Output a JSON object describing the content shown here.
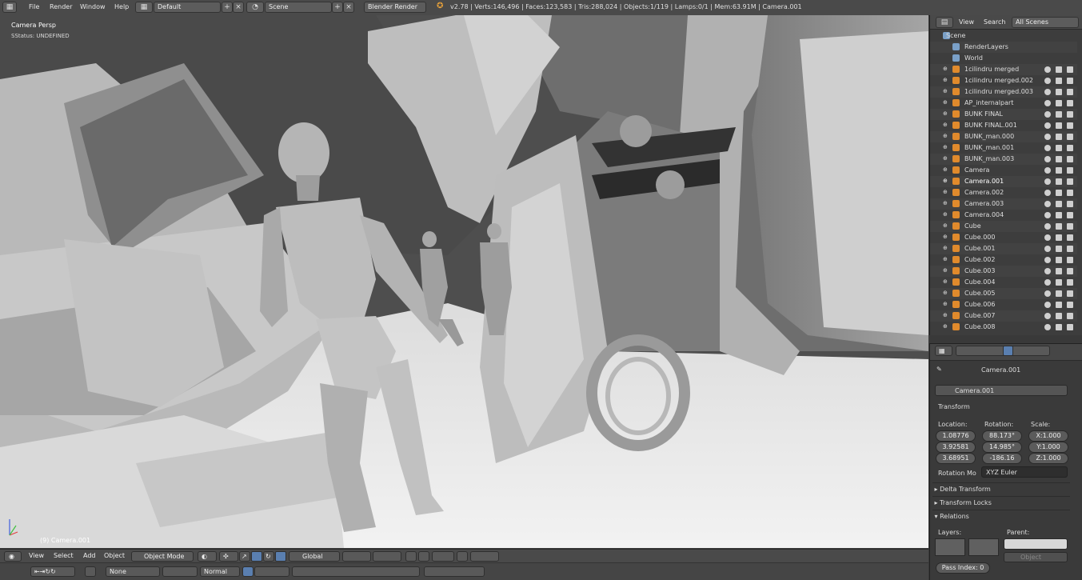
{
  "menus": {
    "file": "File",
    "render": "Render",
    "window": "Window",
    "help": "Help"
  },
  "screen_layout": "Default",
  "scene_name": "Scene",
  "render_engine": "Blender Render",
  "stats": "v2.78 | Verts:146,496 | Faces:123,583 | Tris:288,024 | Objects:1/119 | Lamps:0/1 | Mem:63.91M | Camera.001",
  "viewport": {
    "view_name": "Camera Persp",
    "status": "SStatus: UNDEFINED",
    "active_object": "(9) Camera.001"
  },
  "view3d_header": {
    "view": "View",
    "select": "Select",
    "add": "Add",
    "object": "Object",
    "mode": "Object Mode",
    "orientation": "Global"
  },
  "timeline_header": {
    "keying_none": "None",
    "blend": "Normal"
  },
  "outliner": {
    "view": "View",
    "search": "Search",
    "filter": "All Scenes",
    "rows": [
      {
        "name": "Scene"
      },
      {
        "name": "RenderLayers"
      },
      {
        "name": "World"
      },
      {
        "name": "1cilindru merged"
      },
      {
        "name": "1cilindru merged.002"
      },
      {
        "name": "1cilindru merged.003"
      },
      {
        "name": "AP_internalpart"
      },
      {
        "name": "BUNK FINAL"
      },
      {
        "name": "BUNK FINAL.001"
      },
      {
        "name": "BUNK_man.000"
      },
      {
        "name": "BUNK_man.001"
      },
      {
        "name": "BUNK_man.003"
      },
      {
        "name": "Camera"
      },
      {
        "name": "Camera.001"
      },
      {
        "name": "Camera.002"
      },
      {
        "name": "Camera.003"
      },
      {
        "name": "Camera.004"
      },
      {
        "name": "Cube"
      },
      {
        "name": "Cube.000"
      },
      {
        "name": "Cube.001"
      },
      {
        "name": "Cube.002"
      },
      {
        "name": "Cube.003"
      },
      {
        "name": "Cube.004"
      },
      {
        "name": "Cube.005"
      },
      {
        "name": "Cube.006"
      },
      {
        "name": "Cube.007"
      },
      {
        "name": "Cube.008"
      }
    ]
  },
  "properties": {
    "breadcrumb": "Camera.001",
    "object_name": "Camera.001",
    "transform_label": "Transform",
    "location_label": "Location:",
    "rotation_label": "Rotation:",
    "scale_label": "Scale:",
    "location": [
      "1.08776",
      "3.92581",
      "3.68951"
    ],
    "rotation": [
      "88.173°",
      "14.985°",
      "-186.16"
    ],
    "scale": [
      "X:1.000",
      "Y:1.000",
      "Z:1.000"
    ],
    "rotation_mode_label": "Rotation Mo",
    "rotation_mode": "XYZ Euler",
    "delta_transform": "Delta Transform",
    "transform_locks": "Transform Locks",
    "relations": "Relations",
    "layers_label": "Layers:",
    "parent_label": "Parent:",
    "parent_type": "Object",
    "pass_index": "Pass Index:",
    "pass_index_value": "0"
  }
}
